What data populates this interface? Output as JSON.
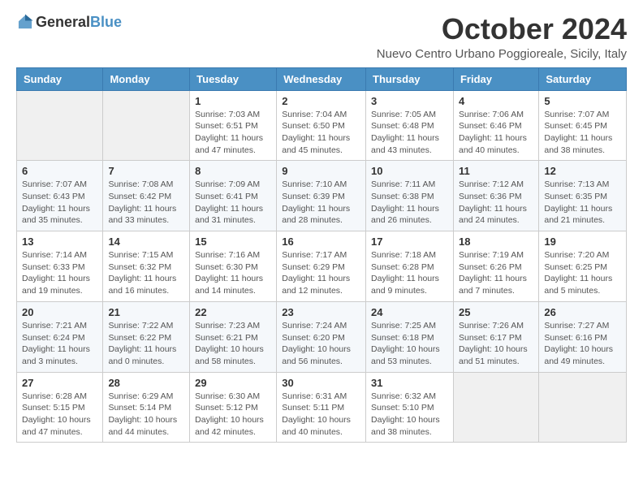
{
  "header": {
    "logo_general": "General",
    "logo_blue": "Blue",
    "month_title": "October 2024",
    "location": "Nuevo Centro Urbano Poggioreale, Sicily, Italy"
  },
  "days_of_week": [
    "Sunday",
    "Monday",
    "Tuesday",
    "Wednesday",
    "Thursday",
    "Friday",
    "Saturday"
  ],
  "weeks": [
    [
      {
        "day": "",
        "info": ""
      },
      {
        "day": "",
        "info": ""
      },
      {
        "day": "1",
        "info": "Sunrise: 7:03 AM\nSunset: 6:51 PM\nDaylight: 11 hours and 47 minutes."
      },
      {
        "day": "2",
        "info": "Sunrise: 7:04 AM\nSunset: 6:50 PM\nDaylight: 11 hours and 45 minutes."
      },
      {
        "day": "3",
        "info": "Sunrise: 7:05 AM\nSunset: 6:48 PM\nDaylight: 11 hours and 43 minutes."
      },
      {
        "day": "4",
        "info": "Sunrise: 7:06 AM\nSunset: 6:46 PM\nDaylight: 11 hours and 40 minutes."
      },
      {
        "day": "5",
        "info": "Sunrise: 7:07 AM\nSunset: 6:45 PM\nDaylight: 11 hours and 38 minutes."
      }
    ],
    [
      {
        "day": "6",
        "info": "Sunrise: 7:07 AM\nSunset: 6:43 PM\nDaylight: 11 hours and 35 minutes."
      },
      {
        "day": "7",
        "info": "Sunrise: 7:08 AM\nSunset: 6:42 PM\nDaylight: 11 hours and 33 minutes."
      },
      {
        "day": "8",
        "info": "Sunrise: 7:09 AM\nSunset: 6:41 PM\nDaylight: 11 hours and 31 minutes."
      },
      {
        "day": "9",
        "info": "Sunrise: 7:10 AM\nSunset: 6:39 PM\nDaylight: 11 hours and 28 minutes."
      },
      {
        "day": "10",
        "info": "Sunrise: 7:11 AM\nSunset: 6:38 PM\nDaylight: 11 hours and 26 minutes."
      },
      {
        "day": "11",
        "info": "Sunrise: 7:12 AM\nSunset: 6:36 PM\nDaylight: 11 hours and 24 minutes."
      },
      {
        "day": "12",
        "info": "Sunrise: 7:13 AM\nSunset: 6:35 PM\nDaylight: 11 hours and 21 minutes."
      }
    ],
    [
      {
        "day": "13",
        "info": "Sunrise: 7:14 AM\nSunset: 6:33 PM\nDaylight: 11 hours and 19 minutes."
      },
      {
        "day": "14",
        "info": "Sunrise: 7:15 AM\nSunset: 6:32 PM\nDaylight: 11 hours and 16 minutes."
      },
      {
        "day": "15",
        "info": "Sunrise: 7:16 AM\nSunset: 6:30 PM\nDaylight: 11 hours and 14 minutes."
      },
      {
        "day": "16",
        "info": "Sunrise: 7:17 AM\nSunset: 6:29 PM\nDaylight: 11 hours and 12 minutes."
      },
      {
        "day": "17",
        "info": "Sunrise: 7:18 AM\nSunset: 6:28 PM\nDaylight: 11 hours and 9 minutes."
      },
      {
        "day": "18",
        "info": "Sunrise: 7:19 AM\nSunset: 6:26 PM\nDaylight: 11 hours and 7 minutes."
      },
      {
        "day": "19",
        "info": "Sunrise: 7:20 AM\nSunset: 6:25 PM\nDaylight: 11 hours and 5 minutes."
      }
    ],
    [
      {
        "day": "20",
        "info": "Sunrise: 7:21 AM\nSunset: 6:24 PM\nDaylight: 11 hours and 3 minutes."
      },
      {
        "day": "21",
        "info": "Sunrise: 7:22 AM\nSunset: 6:22 PM\nDaylight: 11 hours and 0 minutes."
      },
      {
        "day": "22",
        "info": "Sunrise: 7:23 AM\nSunset: 6:21 PM\nDaylight: 10 hours and 58 minutes."
      },
      {
        "day": "23",
        "info": "Sunrise: 7:24 AM\nSunset: 6:20 PM\nDaylight: 10 hours and 56 minutes."
      },
      {
        "day": "24",
        "info": "Sunrise: 7:25 AM\nSunset: 6:18 PM\nDaylight: 10 hours and 53 minutes."
      },
      {
        "day": "25",
        "info": "Sunrise: 7:26 AM\nSunset: 6:17 PM\nDaylight: 10 hours and 51 minutes."
      },
      {
        "day": "26",
        "info": "Sunrise: 7:27 AM\nSunset: 6:16 PM\nDaylight: 10 hours and 49 minutes."
      }
    ],
    [
      {
        "day": "27",
        "info": "Sunrise: 6:28 AM\nSunset: 5:15 PM\nDaylight: 10 hours and 47 minutes."
      },
      {
        "day": "28",
        "info": "Sunrise: 6:29 AM\nSunset: 5:14 PM\nDaylight: 10 hours and 44 minutes."
      },
      {
        "day": "29",
        "info": "Sunrise: 6:30 AM\nSunset: 5:12 PM\nDaylight: 10 hours and 42 minutes."
      },
      {
        "day": "30",
        "info": "Sunrise: 6:31 AM\nSunset: 5:11 PM\nDaylight: 10 hours and 40 minutes."
      },
      {
        "day": "31",
        "info": "Sunrise: 6:32 AM\nSunset: 5:10 PM\nDaylight: 10 hours and 38 minutes."
      },
      {
        "day": "",
        "info": ""
      },
      {
        "day": "",
        "info": ""
      }
    ]
  ]
}
